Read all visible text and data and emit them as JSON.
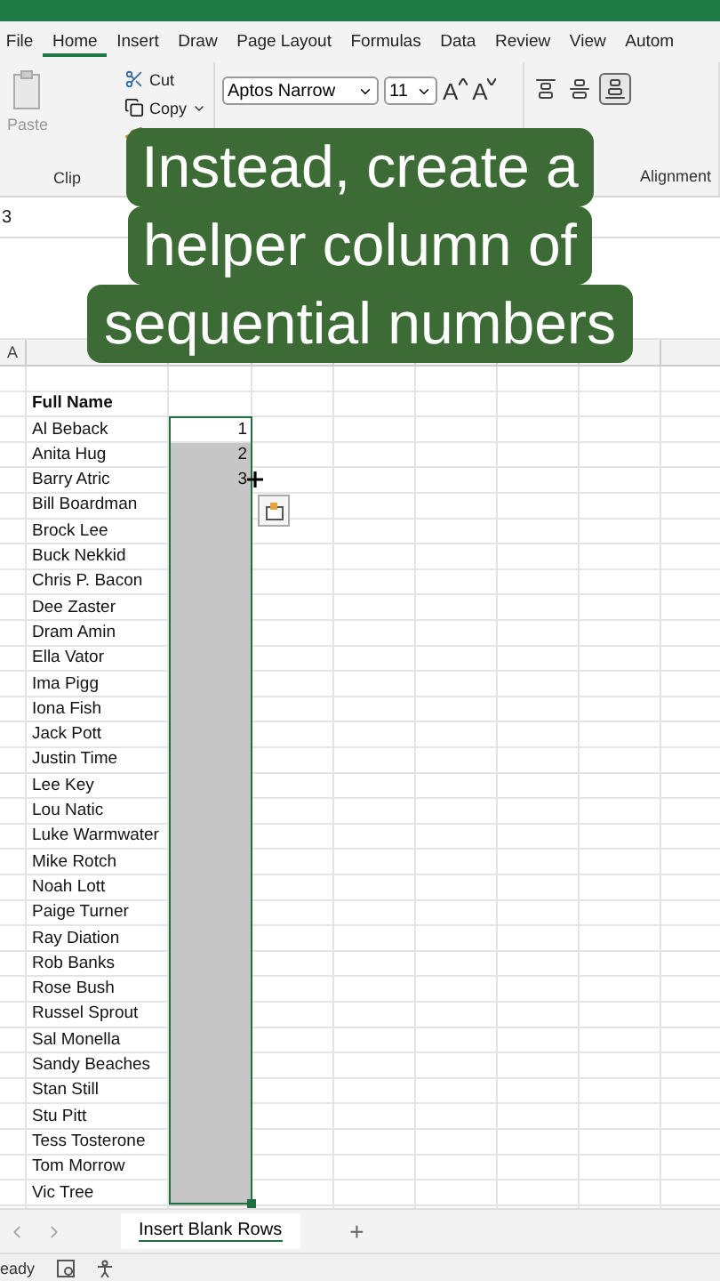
{
  "ribbon_tabs": [
    {
      "label": "File",
      "selected": false
    },
    {
      "label": "Home",
      "selected": true
    },
    {
      "label": "Insert",
      "selected": false
    },
    {
      "label": "Draw",
      "selected": false
    },
    {
      "label": "Page Layout",
      "selected": false
    },
    {
      "label": "Formulas",
      "selected": false
    },
    {
      "label": "Data",
      "selected": false
    },
    {
      "label": "Review",
      "selected": false
    },
    {
      "label": "View",
      "selected": false
    },
    {
      "label": "Autom",
      "selected": false
    }
  ],
  "clipboard": {
    "paste": "Paste",
    "cut": "Cut",
    "copy": "Copy",
    "group_label": "Clip"
  },
  "font": {
    "name": "Aptos Narrow",
    "size": "11",
    "grow": "A",
    "shrink": "A"
  },
  "alignment": {
    "group_label": "Alignment",
    "buttons": [
      {
        "kind": "top",
        "pressed": false
      },
      {
        "kind": "middle",
        "pressed": false
      },
      {
        "kind": "bottom",
        "pressed": true
      }
    ]
  },
  "name_box": "3",
  "caption": [
    "Instead, create a",
    "helper column of",
    "sequential numbers"
  ],
  "columns": [
    "A"
  ],
  "header": "Full Name",
  "rows": [
    {
      "name": "Al Beback",
      "number": "1",
      "selected": true,
      "active": true
    },
    {
      "name": "Anita Hug",
      "number": "2",
      "selected": true,
      "active": false
    },
    {
      "name": "Barry Atric",
      "number": "3",
      "selected": true,
      "active": false
    },
    {
      "name": "Bill Boardman",
      "selected": true,
      "active": false
    },
    {
      "name": "Brock Lee",
      "selected": true,
      "active": false
    },
    {
      "name": "Buck Nekkid",
      "selected": true,
      "active": false
    },
    {
      "name": "Chris P. Bacon",
      "selected": true,
      "active": false
    },
    {
      "name": "Dee Zaster",
      "selected": true,
      "active": false
    },
    {
      "name": "Dram Amin",
      "selected": true,
      "active": false
    },
    {
      "name": "Ella Vator",
      "selected": true,
      "active": false
    },
    {
      "name": "Ima Pigg",
      "selected": true,
      "active": false
    },
    {
      "name": "Iona Fish",
      "selected": true,
      "active": false
    },
    {
      "name": "Jack Pott",
      "selected": true,
      "active": false
    },
    {
      "name": "Justin Time",
      "selected": true,
      "active": false
    },
    {
      "name": "Lee Key",
      "selected": true,
      "active": false
    },
    {
      "name": "Lou Natic",
      "selected": true,
      "active": false
    },
    {
      "name": "Luke Warmwater",
      "selected": true,
      "active": false
    },
    {
      "name": "Mike Rotch",
      "selected": true,
      "active": false
    },
    {
      "name": "Noah Lott",
      "selected": true,
      "active": false
    },
    {
      "name": "Paige Turner",
      "selected": true,
      "active": false
    },
    {
      "name": "Ray Diation",
      "selected": true,
      "active": false
    },
    {
      "name": "Rob Banks",
      "selected": true,
      "active": false
    },
    {
      "name": "Rose Bush",
      "selected": true,
      "active": false
    },
    {
      "name": "Russel Sprout",
      "selected": true,
      "active": false
    },
    {
      "name": "Sal Monella",
      "selected": true,
      "active": false
    },
    {
      "name": "Sandy Beaches",
      "selected": true,
      "active": false
    },
    {
      "name": "Stan Still",
      "selected": true,
      "active": false
    },
    {
      "name": "Stu Pitt",
      "selected": true,
      "active": false
    },
    {
      "name": "Tess Tosterone",
      "selected": true,
      "active": false
    },
    {
      "name": "Tom Morrow",
      "selected": true,
      "active": false
    },
    {
      "name": "Vic Tree",
      "selected": true,
      "active": false
    }
  ],
  "sheet_tabs": [
    {
      "label": "Insert Blank Rows",
      "selected": true
    }
  ],
  "add_sheet": "+",
  "status": "eady"
}
